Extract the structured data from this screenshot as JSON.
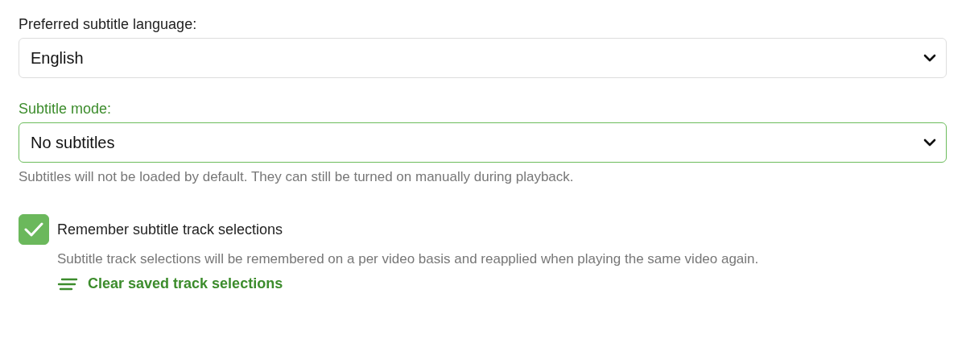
{
  "fields": [
    {
      "label": "Preferred subtitle language:",
      "value": "English",
      "focused": false
    },
    {
      "label": "Subtitle mode:",
      "value": "No subtitles",
      "focused": true,
      "help": "Subtitles will not be loaded by default. They can still be turned on manually during playback."
    }
  ],
  "checkbox": {
    "label": "Remember subtitle track selections",
    "checked": true,
    "help": "Subtitle track selections will be remembered on a per video basis and reapplied when playing the same video again."
  },
  "link": {
    "label": "Clear saved track selections"
  }
}
